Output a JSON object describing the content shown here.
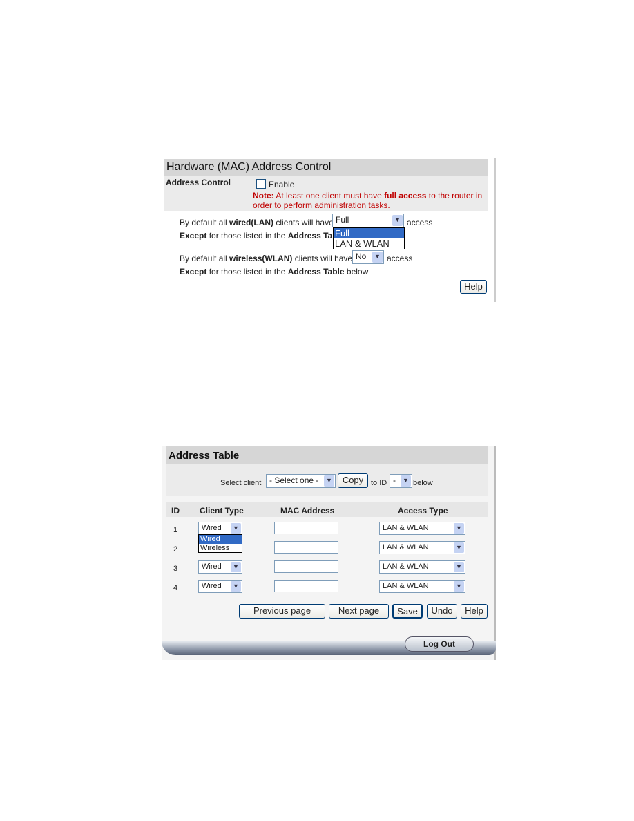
{
  "mac_control": {
    "title": "Hardware (MAC) Address Control",
    "address_control_label": "Address Control",
    "enable_label": "Enable",
    "enable_checked": false,
    "note_prefix": "Note:",
    "note_text1": " At least one client must have ",
    "note_bold": "full access",
    "note_text2": " to the router in",
    "note_line2": "order to perform administration tasks.",
    "wired_pre": "By default all ",
    "wired_bold": "wired(LAN)",
    "wired_post": " clients will have:",
    "wired_value": "Full",
    "wired_options": [
      "Full",
      "LAN & WLAN"
    ],
    "access": "access",
    "except_bold": "Except",
    "except_text": " for those listed in the ",
    "except_table": "Address Table",
    "except_below": " below",
    "wireless_pre": "By default all ",
    "wireless_bold": "wireless(WLAN)",
    "wireless_post": " clients will have:",
    "wireless_value": "No",
    "help": "Help"
  },
  "address_table": {
    "title": "Address Table",
    "select_client_label": "Select client",
    "select_client_value": "- Select one -",
    "copy": "Copy",
    "to_id": "to ID",
    "to_id_value": "-",
    "below": "below",
    "columns": [
      "ID",
      "Client Type",
      "MAC Address",
      "Access Type"
    ],
    "rows": [
      {
        "id": "1",
        "client_type": "Wired",
        "mac": "",
        "access": "LAN & WLAN"
      },
      {
        "id": "2",
        "client_type": "",
        "mac": "",
        "access": "LAN & WLAN"
      },
      {
        "id": "3",
        "client_type": "Wired",
        "mac": "",
        "access": "LAN & WLAN"
      },
      {
        "id": "4",
        "client_type": "Wired",
        "mac": "",
        "access": "LAN & WLAN"
      }
    ],
    "client_type_options": [
      "Wired",
      "Wireless"
    ],
    "buttons": {
      "prev": "Previous page",
      "next": "Next page",
      "save": "Save",
      "undo": "Undo",
      "help": "Help"
    },
    "logout": "Log Out"
  }
}
